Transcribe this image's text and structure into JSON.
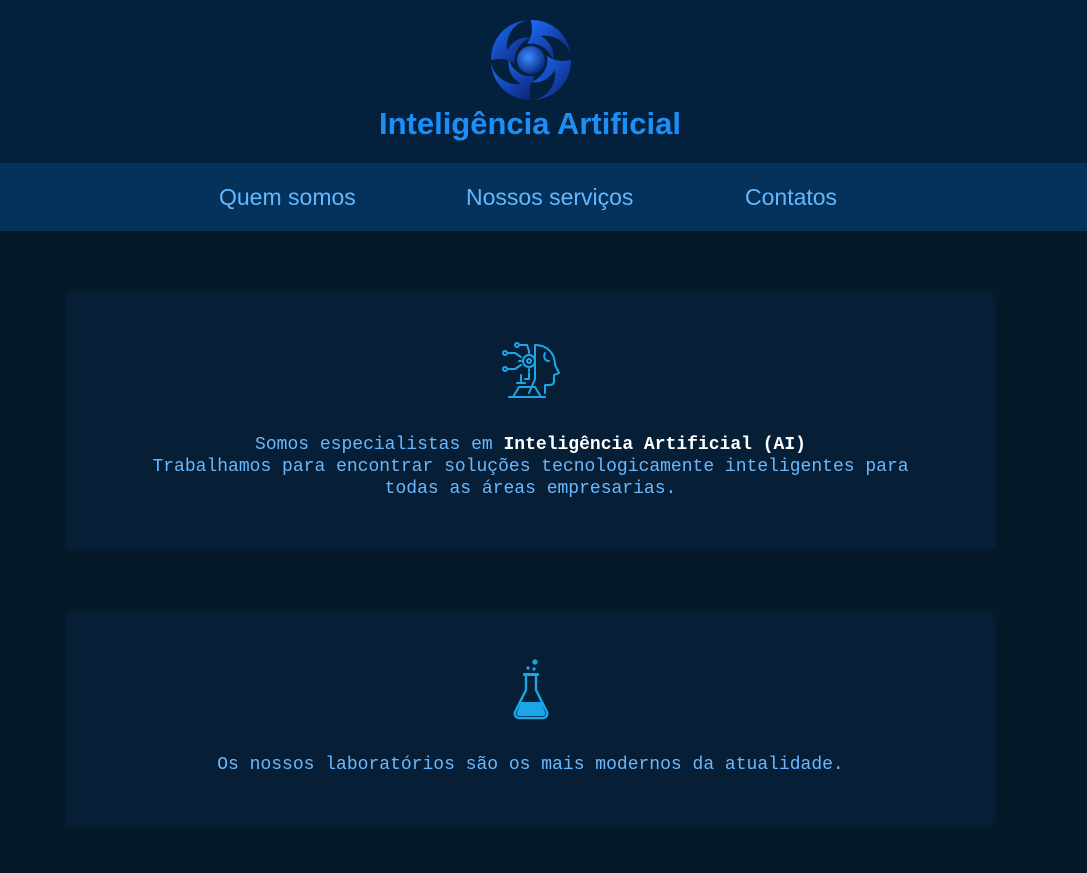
{
  "header": {
    "title": "Inteligência Artificial",
    "logo_icon": "swirl-globe-logo"
  },
  "nav": {
    "items": [
      {
        "label": "Quem somos"
      },
      {
        "label": "Nossos serviços"
      },
      {
        "label": "Contatos"
      }
    ]
  },
  "cards": [
    {
      "icon": "ai-head-circuit-icon",
      "line1_prefix": "Somos especialistas em ",
      "line1_highlight": "Inteligência Artificial (AI)",
      "line2": "Trabalhamos para encontrar soluções tecnologicamente inteligentes para",
      "line3": "todas as áreas empresarias."
    },
    {
      "icon": "flask-icon",
      "text": "Os nossos laboratórios são os mais modernos da atualidade."
    }
  ],
  "colors": {
    "header_bg": "#03213d",
    "nav_bg": "#05325a",
    "page_bg": "#061929",
    "card_bg": "#061f36",
    "title": "#1e8ef7",
    "nav_text": "#63b7ff",
    "body_text": "#69b8ff",
    "icon": "#1aa6e8"
  }
}
